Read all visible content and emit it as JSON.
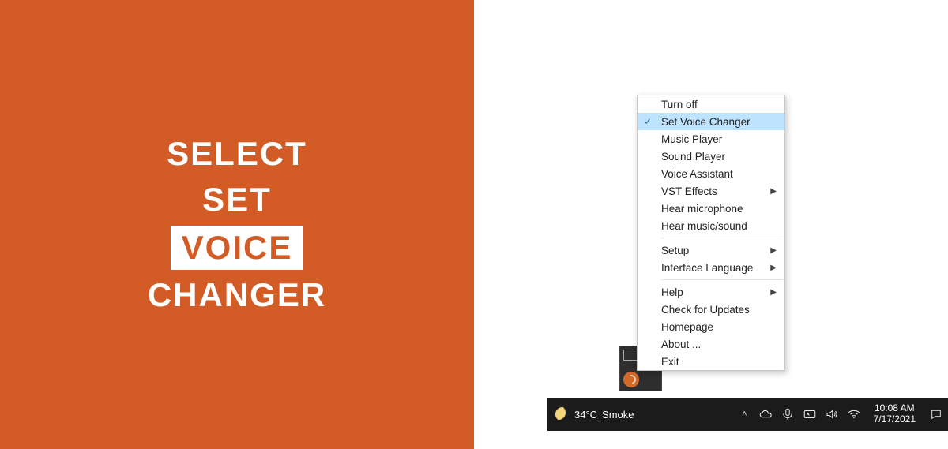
{
  "hero": {
    "line1": "SELECT",
    "line2": "SET",
    "line3_boxed": "VOICE",
    "line4": "CHANGER"
  },
  "context_menu": {
    "groups": [
      [
        {
          "label": "Turn off",
          "checked": false,
          "submenu": false
        },
        {
          "label": "Set Voice Changer",
          "checked": true,
          "submenu": false,
          "highlighted": true
        },
        {
          "label": "Music Player",
          "checked": false,
          "submenu": false
        },
        {
          "label": "Sound Player",
          "checked": false,
          "submenu": false
        },
        {
          "label": "Voice Assistant",
          "checked": false,
          "submenu": false
        },
        {
          "label": "VST Effects",
          "checked": false,
          "submenu": true
        },
        {
          "label": "Hear microphone",
          "checked": false,
          "submenu": false
        },
        {
          "label": "Hear music/sound",
          "checked": false,
          "submenu": false
        }
      ],
      [
        {
          "label": "Setup",
          "checked": false,
          "submenu": true
        },
        {
          "label": "Interface Language",
          "checked": false,
          "submenu": true
        }
      ],
      [
        {
          "label": "Help",
          "checked": false,
          "submenu": true
        },
        {
          "label": "Check for Updates",
          "checked": false,
          "submenu": false
        },
        {
          "label": "Homepage",
          "checked": false,
          "submenu": false
        },
        {
          "label": "About ...",
          "checked": false,
          "submenu": false
        },
        {
          "label": "Exit",
          "checked": false,
          "submenu": false
        }
      ]
    ]
  },
  "taskbar": {
    "weather_temp": "34°C",
    "weather_label": "Smoke",
    "time": "10:08 AM",
    "date": "7/17/2021"
  }
}
